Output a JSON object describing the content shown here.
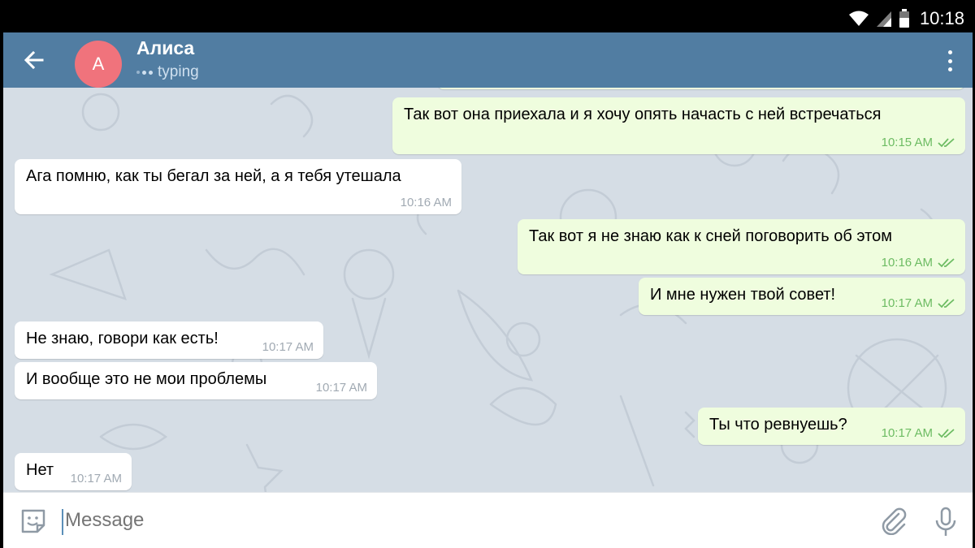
{
  "status_bar": {
    "time": "10:18"
  },
  "header": {
    "avatar_letter": "A",
    "name": "Алиса",
    "status": "typing"
  },
  "messages": [
    {
      "dir": "out",
      "text": "Так вот она приехала и я хочу опять начасть с ней встречаться",
      "time": "10:15 AM"
    },
    {
      "dir": "in",
      "text": "Ага помню, как ты бегал за ней, а я тебя утешала",
      "time": "10:16 AM"
    },
    {
      "dir": "out",
      "text": "Так вот я не знаю как к сней поговорить об этом",
      "time": "10:16 AM"
    },
    {
      "dir": "out",
      "text": "И мне нужен твой совет!",
      "time": "10:17 AM"
    },
    {
      "dir": "in",
      "text": "Не знаю, говори как есть!",
      "time": "10:17 AM"
    },
    {
      "dir": "in",
      "text": "И вообще это не мои проблемы",
      "time": "10:17 AM"
    },
    {
      "dir": "out",
      "text": "Ты что ревнуешь?",
      "time": "10:17 AM"
    },
    {
      "dir": "in",
      "text": "Нет",
      "time": "10:17 AM"
    }
  ],
  "input": {
    "placeholder": "Message"
  },
  "icons": {
    "back": "arrow-left-icon",
    "menu": "more-vertical-icon",
    "emoji": "sticker-emoji-icon",
    "attach": "paperclip-icon",
    "voice": "microphone-icon",
    "read": "double-check-icon"
  },
  "colors": {
    "header": "#517da2",
    "avatar": "#f0737c",
    "background": "#d5dde5",
    "outgoing_bubble": "#effdde",
    "incoming_bubble": "#ffffff",
    "outgoing_time": "#6dbc63",
    "incoming_time": "#a1aab3"
  }
}
